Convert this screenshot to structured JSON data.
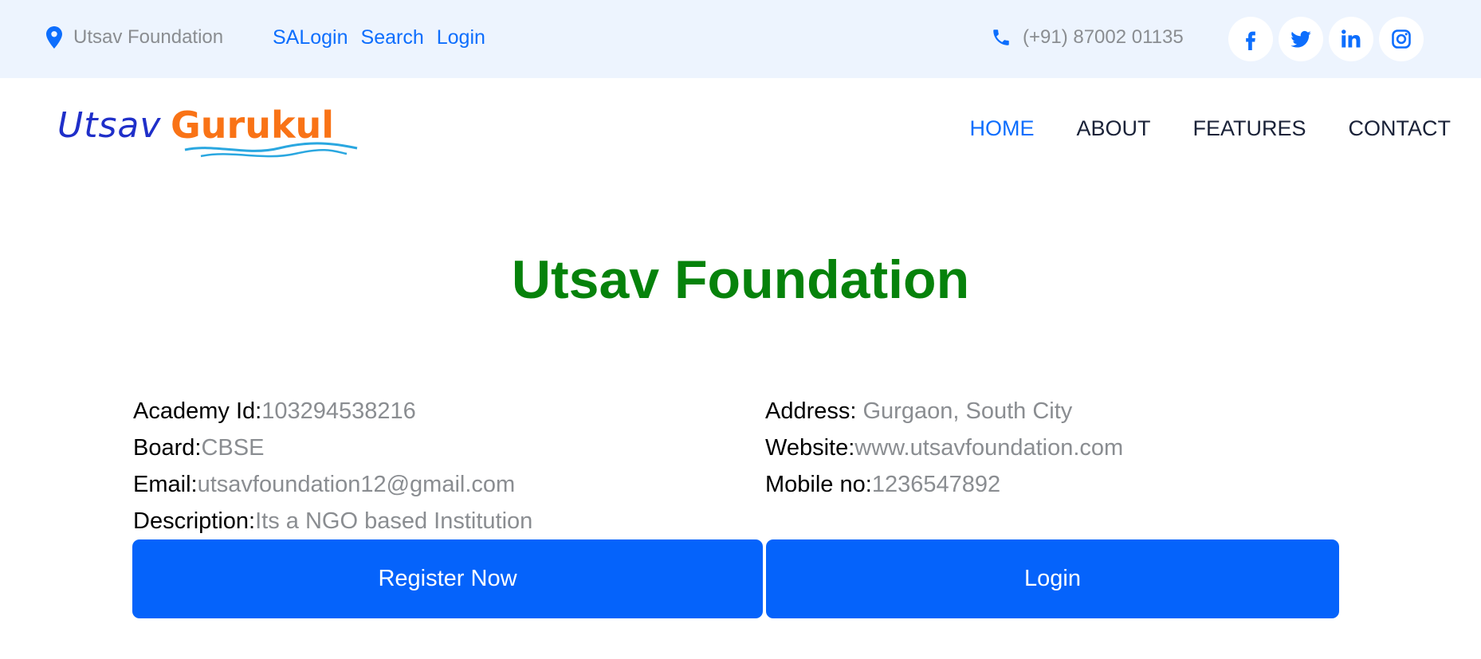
{
  "topbar": {
    "location": "Utsav Foundation",
    "links": [
      "SALogin",
      "Search",
      "Login"
    ],
    "phone": "(+91) 87002 01135",
    "social": [
      "facebook-icon",
      "twitter-icon",
      "linkedin-icon",
      "instagram-icon"
    ]
  },
  "logo": {
    "part1": "Utsav",
    "part2": "Gurukul"
  },
  "nav": {
    "items": [
      "HOME",
      "ABOUT",
      "FEATURES",
      "CONTACT"
    ],
    "active": "HOME"
  },
  "main": {
    "title": "Utsav Foundation",
    "left": [
      {
        "label": "Academy Id:",
        "value": "103294538216"
      },
      {
        "label": "Board:",
        "value": "CBSE"
      },
      {
        "label": "Email:",
        "value": "utsavfoundation12@gmail.com"
      },
      {
        "label": "Description:",
        "value": "Its a NGO based Institution"
      }
    ],
    "right": [
      {
        "label": "Address: ",
        "value": "Gurgaon, South City"
      },
      {
        "label": "Website:",
        "value": "www.utsavfoundation.com"
      },
      {
        "label": "Mobile no:",
        "value": "1236547892"
      }
    ],
    "register_label": "Register Now",
    "login_label": "Login"
  },
  "colors": {
    "accent": "#0d6efd",
    "button": "#0563fb",
    "title": "#06820b",
    "topbar_bg": "#edf4fe",
    "muted": "#8a8d91"
  }
}
